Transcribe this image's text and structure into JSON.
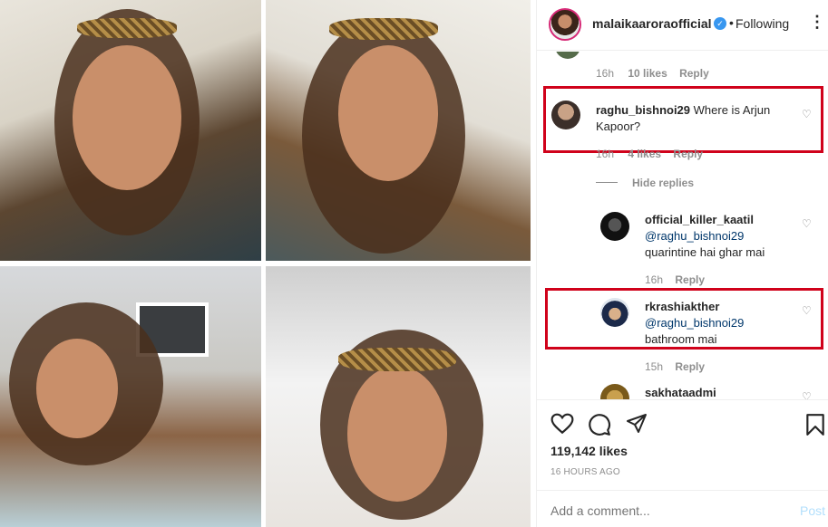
{
  "header": {
    "username": "malaikaaroraofficial",
    "separator": "•",
    "follow_label": "Following",
    "more": "⋮"
  },
  "comments": {
    "top_meta": {
      "time": "16h",
      "likes": "10 likes",
      "reply": "Reply"
    },
    "c1": {
      "username": "raghu_bishnoi29",
      "text": "Where is Arjun Kapoor?",
      "time": "16h",
      "likes": "4 likes",
      "reply": "Reply"
    },
    "hide_replies": "Hide replies",
    "r1": {
      "username": "official_killer_kaatil",
      "mention": "@raghu_bishnoi29",
      "text": "quarintine hai ghar mai",
      "time": "16h",
      "reply": "Reply"
    },
    "r2": {
      "username": "rkrashiakther",
      "mention": "@raghu_bishnoi29",
      "text": "bathroom mai",
      "time": "15h",
      "reply": "Reply"
    },
    "r3": {
      "username": "sakhataadmi"
    }
  },
  "post": {
    "likes": "119,142 likes",
    "time": "16 HOURS AGO",
    "add_comment_placeholder": "Add a comment...",
    "post_label": "Post"
  },
  "colors": {
    "highlight": "#d0021b",
    "verified": "#3897f0",
    "post_disabled": "#b2dffc"
  },
  "icons": [
    "heart-icon",
    "comment-icon",
    "share-icon",
    "bookmark-icon",
    "more-icon",
    "verified-icon"
  ]
}
